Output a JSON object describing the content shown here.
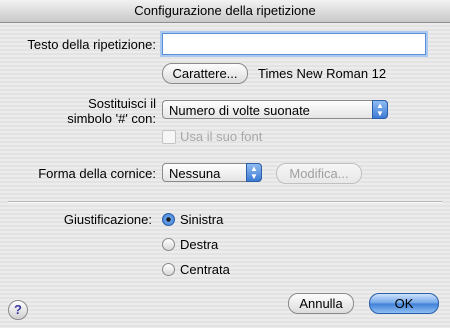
{
  "window": {
    "title": "Configurazione della ripetizione"
  },
  "text": {
    "label": "Testo della ripetizione:",
    "value": "",
    "font_button": "Carattere...",
    "font_name": "Times New Roman 12"
  },
  "replace": {
    "label_line1": "Sostituisci il",
    "label_line2": "simbolo '#' con:",
    "selected": "Numero di volte suonate",
    "use_font_label": "Usa il suo font",
    "use_font_checked": false
  },
  "frame": {
    "label": "Forma della cornice:",
    "selected": "Nessuna",
    "edit_button": "Modifica..."
  },
  "justification": {
    "label": "Giustificazione:",
    "options": [
      "Sinistra",
      "Destra",
      "Centrata"
    ],
    "selected": "Sinistra"
  },
  "buttons": {
    "cancel": "Annulla",
    "ok": "OK",
    "help": "?"
  }
}
